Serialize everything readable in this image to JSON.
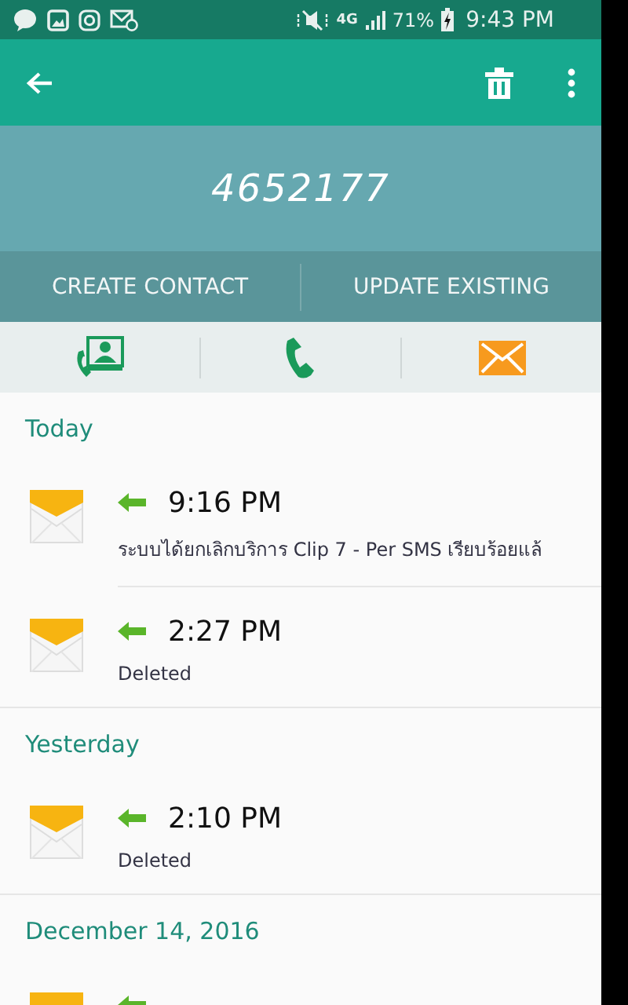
{
  "status_bar": {
    "network": "4G",
    "battery": "71%",
    "time": "9:43 PM"
  },
  "header": {
    "number": "4652177"
  },
  "actions": [
    "CREATE CONTACT",
    "UPDATE EXISTING"
  ],
  "sections": [
    {
      "date": "Today",
      "messages": [
        {
          "incoming": true,
          "time": "9:16 PM",
          "text": "ระบบได้ยกเลิกบริการ Clip 7 - Per SMS เรียบร้อยแล้"
        },
        {
          "incoming": true,
          "time": "2:27 PM",
          "text": "Deleted"
        }
      ]
    },
    {
      "date": "Yesterday",
      "messages": [
        {
          "incoming": true,
          "time": "2:10 PM",
          "text": "Deleted"
        }
      ]
    },
    {
      "date": "December 14, 2016",
      "messages": [
        {
          "incoming": true
        }
      ]
    }
  ]
}
